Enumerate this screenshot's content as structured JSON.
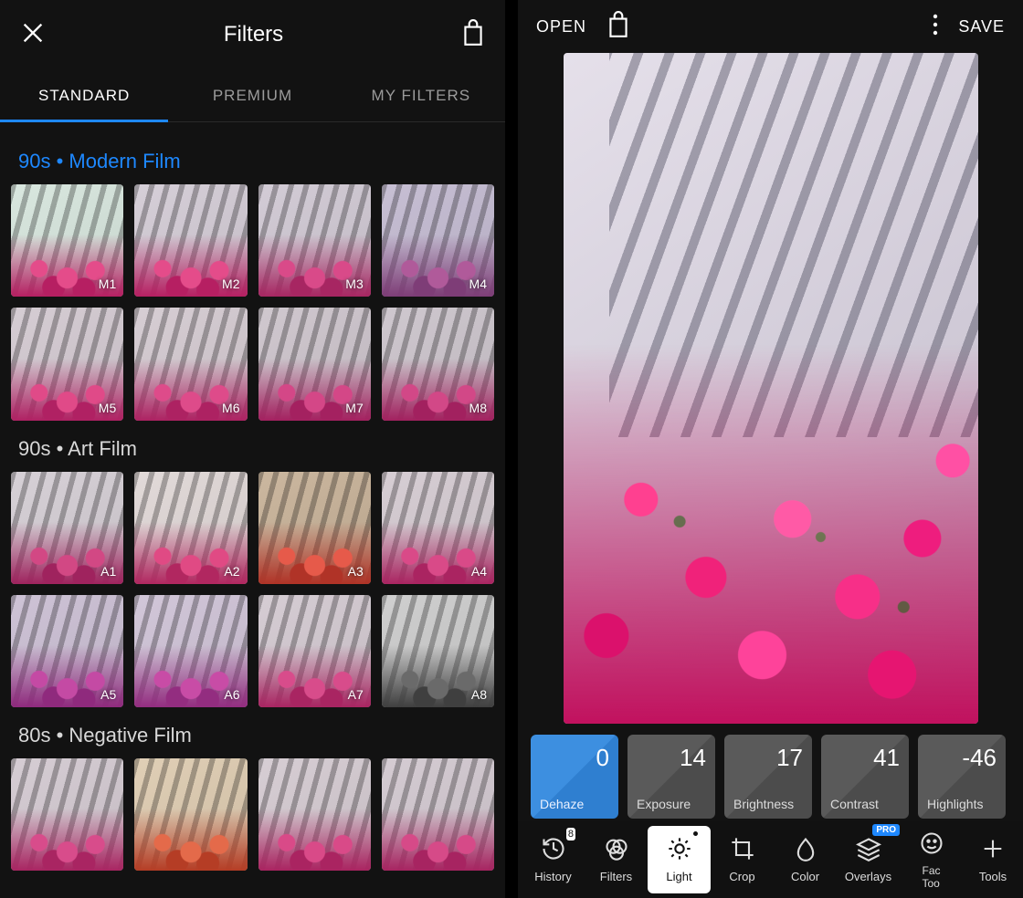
{
  "left": {
    "title": "Filters",
    "tabs": [
      "STANDARD",
      "PREMIUM",
      "MY FILTERS"
    ],
    "active_tab": 0,
    "sections": [
      {
        "title": "90s • Modern Film",
        "accent": true,
        "filters": [
          "M1",
          "M2",
          "M3",
          "M4",
          "M5",
          "M6",
          "M7",
          "M8"
        ],
        "tints": [
          {
            "wall": "#d9e7df",
            "fc": "#e44c8a",
            "fd": "#b61f62"
          },
          {
            "wall": "#d6cfd8",
            "fc": "#e44c8a",
            "fd": "#b61f62"
          },
          {
            "wall": "#d3ccd6",
            "fc": "#d94a89",
            "fd": "#a72662"
          },
          {
            "wall": "#c7bfd4",
            "fc": "#b05a9a",
            "fd": "#7e3d77"
          },
          {
            "wall": "#d6cdd4",
            "fc": "#e04a88",
            "fd": "#b02163"
          },
          {
            "wall": "#d7ced4",
            "fc": "#de4b8a",
            "fd": "#ad2262"
          },
          {
            "wall": "#d0c8cf",
            "fc": "#d44787",
            "fd": "#a42160"
          },
          {
            "wall": "#cfc8cf",
            "fc": "#d24887",
            "fd": "#a2215f"
          }
        ]
      },
      {
        "title": "90s • Art Film",
        "accent": false,
        "filters": [
          "A1",
          "A2",
          "A3",
          "A4",
          "A5",
          "A6",
          "A7",
          "A8"
        ],
        "tints": [
          {
            "wall": "#d7d1d7",
            "fc": "#d24884",
            "fd": "#9f235e"
          },
          {
            "wall": "#e2dad9",
            "fc": "#e04a84",
            "fd": "#b12760"
          },
          {
            "wall": "#cbb79f",
            "fc": "#e65a4a",
            "fd": "#b03327"
          },
          {
            "wall": "#d7ced4",
            "fc": "#d94a88",
            "fd": "#aa2461"
          },
          {
            "wall": "#cec3d6",
            "fc": "#c44aa4",
            "fd": "#8f2a7d"
          },
          {
            "wall": "#d2c7d9",
            "fc": "#c84ca6",
            "fd": "#932d80"
          },
          {
            "wall": "#d6cdd4",
            "fc": "#d84c8b",
            "fd": "#a92562"
          },
          {
            "wall": "#cfcfcf",
            "fc": "#6a6a6a",
            "fd": "#3f3f3f"
          }
        ]
      },
      {
        "title": "80s • Negative Film",
        "accent": false,
        "filters": [
          "",
          "",
          "",
          ""
        ],
        "tints": [
          {
            "wall": "#d6cdd4",
            "fc": "#d84c8b",
            "fd": "#a92562"
          },
          {
            "wall": "#e0cfb6",
            "fc": "#e46a4a",
            "fd": "#b53d25"
          },
          {
            "wall": "#d7ced4",
            "fc": "#d94a88",
            "fd": "#aa2461"
          },
          {
            "wall": "#d5ccd3",
            "fc": "#d64a88",
            "fd": "#a72461"
          }
        ]
      }
    ]
  },
  "right": {
    "open": "OPEN",
    "save": "SAVE",
    "adjustments": [
      {
        "name": "Dehaze",
        "value": "0",
        "active": true
      },
      {
        "name": "Exposure",
        "value": "14"
      },
      {
        "name": "Brightness",
        "value": "17"
      },
      {
        "name": "Contrast",
        "value": "41"
      },
      {
        "name": "Highlights",
        "value": "-46"
      }
    ],
    "tools": [
      {
        "name": "History",
        "icon": "history",
        "badge": "8"
      },
      {
        "name": "Filters",
        "icon": "filters"
      },
      {
        "name": "Light",
        "icon": "light",
        "active": true,
        "dot": true
      },
      {
        "name": "Crop",
        "icon": "crop"
      },
      {
        "name": "Color",
        "icon": "color"
      },
      {
        "name": "Overlays",
        "icon": "overlays",
        "pro": "PRO"
      },
      {
        "name": "Face Tools",
        "icon": "face",
        "cut": true
      },
      {
        "name": "Tools",
        "icon": "tools"
      }
    ]
  }
}
